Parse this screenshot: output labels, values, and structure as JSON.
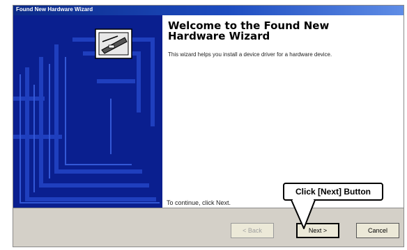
{
  "window": {
    "title": "Found New Hardware Wizard"
  },
  "content": {
    "heading": "Welcome to the Found New Hardware Wizard",
    "description": "This wizard helps you install a device driver for a hardware device.",
    "continue_text": "To continue, click Next."
  },
  "buttons": {
    "back_label": "< Back",
    "next_label": "Next >",
    "cancel_label": "Cancel"
  },
  "annotation": {
    "callout_text": "Click [Next] Button"
  },
  "icons": {
    "wizard_graphic": "hardware-device-icon"
  },
  "colors": {
    "titlebar": "#0b2a88",
    "side_panel": "#0a1f8f",
    "footer": "#d4d0c8"
  }
}
